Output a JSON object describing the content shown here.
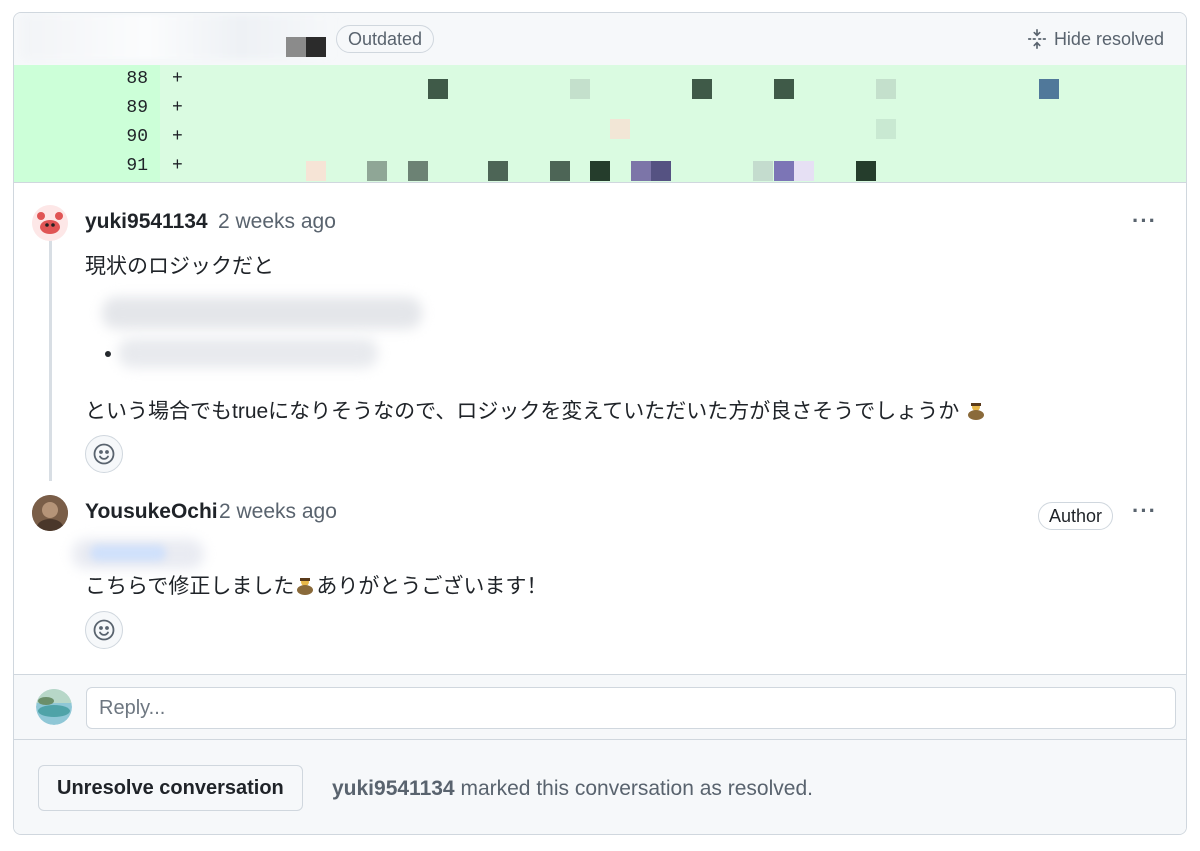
{
  "header": {
    "badge": "Outdated",
    "hide_resolved": "Hide resolved"
  },
  "diff": {
    "lines": [
      {
        "number": "88",
        "sign": "+"
      },
      {
        "number": "89",
        "sign": "+"
      },
      {
        "number": "90",
        "sign": "+"
      },
      {
        "number": "91",
        "sign": "+"
      }
    ]
  },
  "comments": [
    {
      "author": "yuki9541134",
      "time": "2 weeks ago",
      "line1": "現状のロジックだと",
      "line2": "という場合でもtrueになりそうなので、ロジックを変えていただいた方が良さそうでしょうか",
      "more": "···"
    },
    {
      "author": "YousukeOchi",
      "time": "2 weeks ago",
      "badge": "Author",
      "text_before": "こちらで修正しました",
      "text_after": "ありがとうございます！",
      "more": "···"
    }
  ],
  "reply": {
    "placeholder": "Reply..."
  },
  "footer": {
    "button": "Unresolve conversation",
    "resolver": "yuki9541134",
    "status": " marked this conversation as resolved."
  },
  "colors": {
    "diff_bg": "#dafbe1",
    "gutter_bg": "#ccffd8",
    "border": "#d0d7de",
    "muted": "#59636e"
  },
  "icons": [
    "unfold-icon",
    "smiley-icon",
    "bow-emoji-icon",
    "kebab-icon"
  ]
}
